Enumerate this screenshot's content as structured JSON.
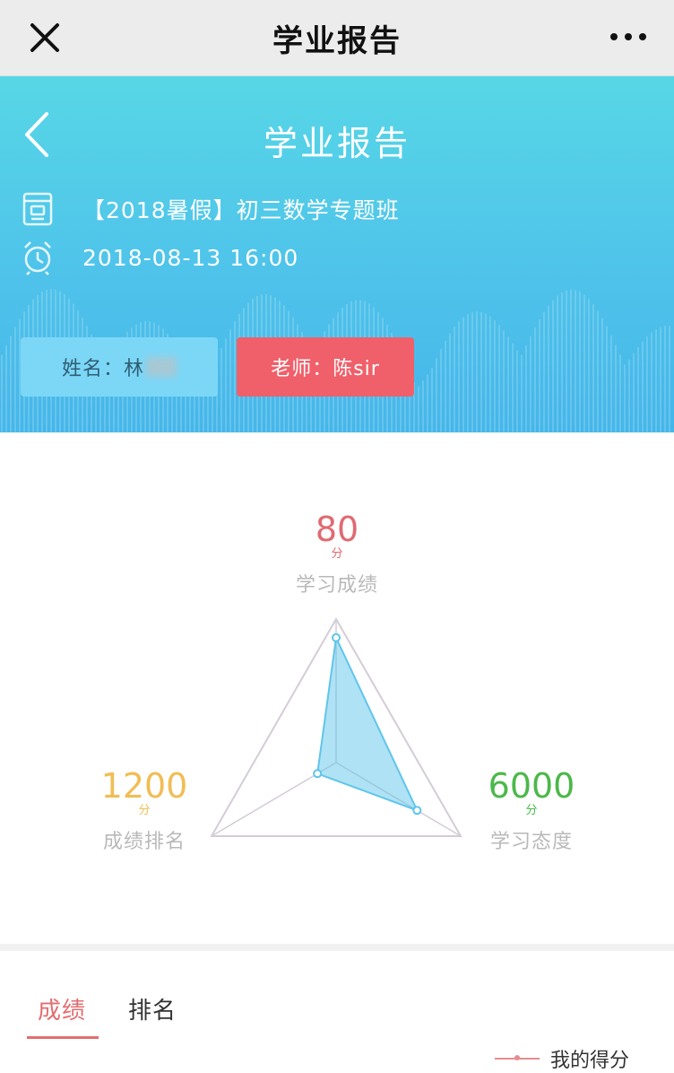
{
  "appbar": {
    "title": "学业报告",
    "close_icon": "close-icon",
    "more_icon": "more-icon"
  },
  "banner": {
    "title": "学业报告",
    "class_name": "【2018暑假】初三数学专题班",
    "datetime": "2018-08-13 16:00",
    "student_label": "姓名：林",
    "teacher_label": "老师：陈sir",
    "colors": {
      "top": "#57d7e6",
      "bottom": "#45b6ea",
      "teacher_chip": "#f0606a"
    }
  },
  "metrics": {
    "score": {
      "value": "80",
      "unit": "分",
      "label": "学习成绩",
      "color": "#e06a72"
    },
    "rank": {
      "value": "1200",
      "unit": "分",
      "label": "成绩排名",
      "color": "#f1bd55"
    },
    "attitude": {
      "value": "6000",
      "unit": "分",
      "label": "学习态度",
      "color": "#4cb84a"
    }
  },
  "radar": {
    "axes": [
      "学习成绩",
      "学习态度",
      "成绩排名"
    ],
    "levels": [
      0.87,
      0.65,
      0.15
    ],
    "fill": "#5fc6ea"
  },
  "tabs": {
    "items": [
      {
        "label": "成绩",
        "active": true
      },
      {
        "label": "排名",
        "active": false
      }
    ],
    "legend_label": "我的得分"
  }
}
